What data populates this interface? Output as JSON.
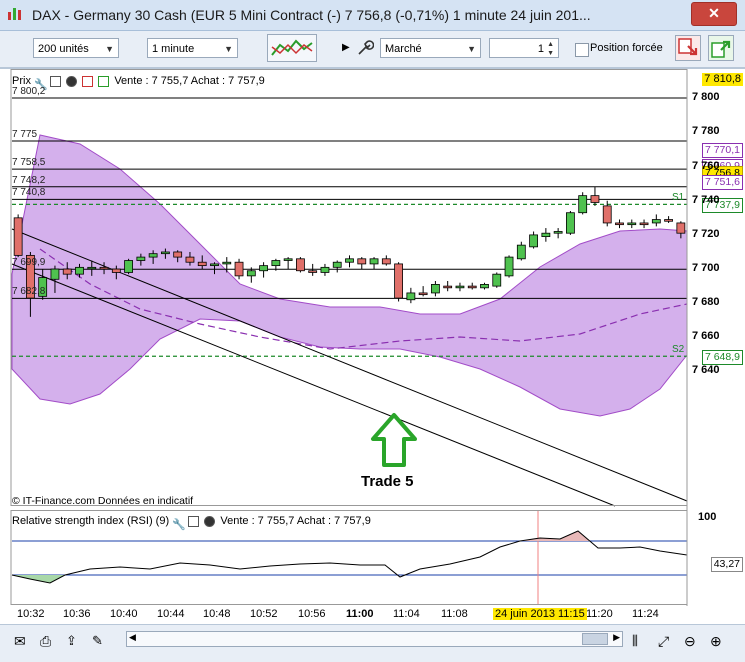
{
  "window": {
    "title": "DAX - Germany 30 Cash (EUR 5 Mini Contract (-)   7 756,8 (-0,71%)     1 minute   24 juin 201...",
    "close_label": "✕"
  },
  "toolbar": {
    "units_value": "200 unités",
    "interval_value": "1 minute",
    "order_type_value": "Marché",
    "quantity_value": "1",
    "forced_position_label": "Position forcée"
  },
  "price_pane": {
    "header_title": "Prix",
    "header_quote": "Vente : 7 755,7 Achat : 7 757,9",
    "corner_tag": "7 810,8",
    "credit": "© IT-Finance.com  Données en indicatif",
    "annotation": "Trade 5",
    "levels": [
      {
        "label": "7 800,2",
        "value": 7800.2
      },
      {
        "label": "7 775",
        "value": 7775
      },
      {
        "label": "7 758,5",
        "value": 7758.5
      },
      {
        "label": "7 748,2",
        "value": 7748.2
      },
      {
        "label": "7 740,8",
        "value": 7740.8
      },
      {
        "label": "7 699,9",
        "value": 7699.9
      },
      {
        "label": "7 682,8",
        "value": 7682.8
      }
    ],
    "pivot_levels": [
      {
        "label": "S1",
        "value": 7737.9
      },
      {
        "label": "S2",
        "value": 7648.9
      }
    ],
    "tags": [
      {
        "text": "7 770,1",
        "value": 7770.1,
        "bg": "#ffffff",
        "fg": "#8a2fb0"
      },
      {
        "text": "7 760,9",
        "value": 7760.9,
        "bg": "#ffffff",
        "fg": "#8a2fb0"
      },
      {
        "text": "7 756,8",
        "value": 7756.8,
        "bg": "#ffe800",
        "fg": "#000000"
      },
      {
        "text": "7 751,6",
        "value": 7751.6,
        "bg": "#ffffff",
        "fg": "#8a2fb0"
      },
      {
        "text": "7 737,9",
        "value": 7737.9,
        "bg": "#ffffff",
        "fg": "#1d8a2a"
      },
      {
        "text": "7 648,9",
        "value": 7648.9,
        "bg": "#ffffff",
        "fg": "#1d8a2a"
      }
    ],
    "axis_ticks": [
      "7 800",
      "7 780",
      "7 760",
      "7 740",
      "7 720",
      "7 700",
      "7 680",
      "7 660",
      "7 640"
    ]
  },
  "rsi_pane": {
    "header_title": "Relative strength index (RSI) (9)",
    "header_quote": "Vente : 7 755,7 Achat : 7 757,9",
    "axis_top": "100",
    "value_tag": "43,27"
  },
  "time_axis": {
    "labels": [
      "10:32",
      "10:36",
      "10:40",
      "10:44",
      "10:48",
      "10:52",
      "10:56",
      "11:00",
      "11:04",
      "11:08",
      "11:20",
      "11:24"
    ],
    "cursor_label": "24 juin 2013 11:15"
  },
  "colors": {
    "bull": "#4fc24f",
    "bear": "#e0706a",
    "band_fill": "#d4b0ec",
    "band_stroke": "#a24cc8",
    "pivot": "#1d8a2a"
  },
  "chart_data": {
    "type": "candlestick",
    "title": "",
    "candles": [
      {
        "o": 7730,
        "h": 7732,
        "l": 7707,
        "c": 7708
      },
      {
        "o": 7708,
        "h": 7710,
        "l": 7672,
        "c": 7683
      },
      {
        "o": 7684,
        "h": 7700,
        "l": 7682,
        "c": 7695
      },
      {
        "o": 7694,
        "h": 7702,
        "l": 7686,
        "c": 7700
      },
      {
        "o": 7700,
        "h": 7704,
        "l": 7694,
        "c": 7697
      },
      {
        "o": 7697,
        "h": 7703,
        "l": 7695,
        "c": 7701
      },
      {
        "o": 7701,
        "h": 7705,
        "l": 7696,
        "c": 7701
      },
      {
        "o": 7701,
        "h": 7704,
        "l": 7697,
        "c": 7700
      },
      {
        "o": 7700,
        "h": 7702,
        "l": 7694,
        "c": 7698
      },
      {
        "o": 7698,
        "h": 7706,
        "l": 7697,
        "c": 7705
      },
      {
        "o": 7705,
        "h": 7709,
        "l": 7702,
        "c": 7707
      },
      {
        "o": 7707,
        "h": 7711,
        "l": 7703,
        "c": 7709
      },
      {
        "o": 7709,
        "h": 7712,
        "l": 7706,
        "c": 7710
      },
      {
        "o": 7710,
        "h": 7711,
        "l": 7704,
        "c": 7707
      },
      {
        "o": 7707,
        "h": 7710,
        "l": 7702,
        "c": 7704
      },
      {
        "o": 7704,
        "h": 7708,
        "l": 7700,
        "c": 7702
      },
      {
        "o": 7702,
        "h": 7704,
        "l": 7697,
        "c": 7703
      },
      {
        "o": 7703,
        "h": 7707,
        "l": 7698,
        "c": 7704
      },
      {
        "o": 7704,
        "h": 7706,
        "l": 7694,
        "c": 7696
      },
      {
        "o": 7696,
        "h": 7701,
        "l": 7692,
        "c": 7699
      },
      {
        "o": 7699,
        "h": 7704,
        "l": 7695,
        "c": 7702
      },
      {
        "o": 7702,
        "h": 7706,
        "l": 7699,
        "c": 7705
      },
      {
        "o": 7705,
        "h": 7707,
        "l": 7700,
        "c": 7706
      },
      {
        "o": 7706,
        "h": 7707,
        "l": 7698,
        "c": 7699
      },
      {
        "o": 7699,
        "h": 7703,
        "l": 7696,
        "c": 7698
      },
      {
        "o": 7698,
        "h": 7703,
        "l": 7696,
        "c": 7701
      },
      {
        "o": 7701,
        "h": 7705,
        "l": 7698,
        "c": 7704
      },
      {
        "o": 7704,
        "h": 7708,
        "l": 7701,
        "c": 7706
      },
      {
        "o": 7706,
        "h": 7707,
        "l": 7700,
        "c": 7703
      },
      {
        "o": 7703,
        "h": 7707,
        "l": 7700,
        "c": 7706
      },
      {
        "o": 7706,
        "h": 7708,
        "l": 7702,
        "c": 7703
      },
      {
        "o": 7703,
        "h": 7704,
        "l": 7681,
        "c": 7683
      },
      {
        "o": 7682,
        "h": 7689,
        "l": 7680,
        "c": 7686
      },
      {
        "o": 7686,
        "h": 7690,
        "l": 7684,
        "c": 7685
      },
      {
        "o": 7686,
        "h": 7693,
        "l": 7684,
        "c": 7691
      },
      {
        "o": 7690,
        "h": 7693,
        "l": 7687,
        "c": 7689
      },
      {
        "o": 7689,
        "h": 7692,
        "l": 7687,
        "c": 7690
      },
      {
        "o": 7690,
        "h": 7692,
        "l": 7688,
        "c": 7689
      },
      {
        "o": 7689,
        "h": 7692,
        "l": 7688,
        "c": 7691
      },
      {
        "o": 7690,
        "h": 7698,
        "l": 7689,
        "c": 7697
      },
      {
        "o": 7696,
        "h": 7708,
        "l": 7695,
        "c": 7707
      },
      {
        "o": 7706,
        "h": 7716,
        "l": 7705,
        "c": 7714
      },
      {
        "o": 7713,
        "h": 7722,
        "l": 7712,
        "c": 7720
      },
      {
        "o": 7719,
        "h": 7724,
        "l": 7716,
        "c": 7721
      },
      {
        "o": 7721,
        "h": 7724,
        "l": 7718,
        "c": 7722
      },
      {
        "o": 7721,
        "h": 7734,
        "l": 7720,
        "c": 7733
      },
      {
        "o": 7733,
        "h": 7745,
        "l": 7732,
        "c": 7743
      },
      {
        "o": 7743,
        "h": 7748,
        "l": 7737,
        "c": 7739
      },
      {
        "o": 7737,
        "h": 7740,
        "l": 7725,
        "c": 7727
      },
      {
        "o": 7727,
        "h": 7729,
        "l": 7724,
        "c": 7726
      },
      {
        "o": 7726,
        "h": 7729,
        "l": 7724,
        "c": 7727
      },
      {
        "o": 7727,
        "h": 7729,
        "l": 7724,
        "c": 7726
      },
      {
        "o": 7727,
        "h": 7732,
        "l": 7725,
        "c": 7729
      },
      {
        "o": 7729,
        "h": 7731,
        "l": 7727,
        "c": 7728
      },
      {
        "o": 7727,
        "h": 7728,
        "l": 7718,
        "c": 7721
      }
    ]
  }
}
